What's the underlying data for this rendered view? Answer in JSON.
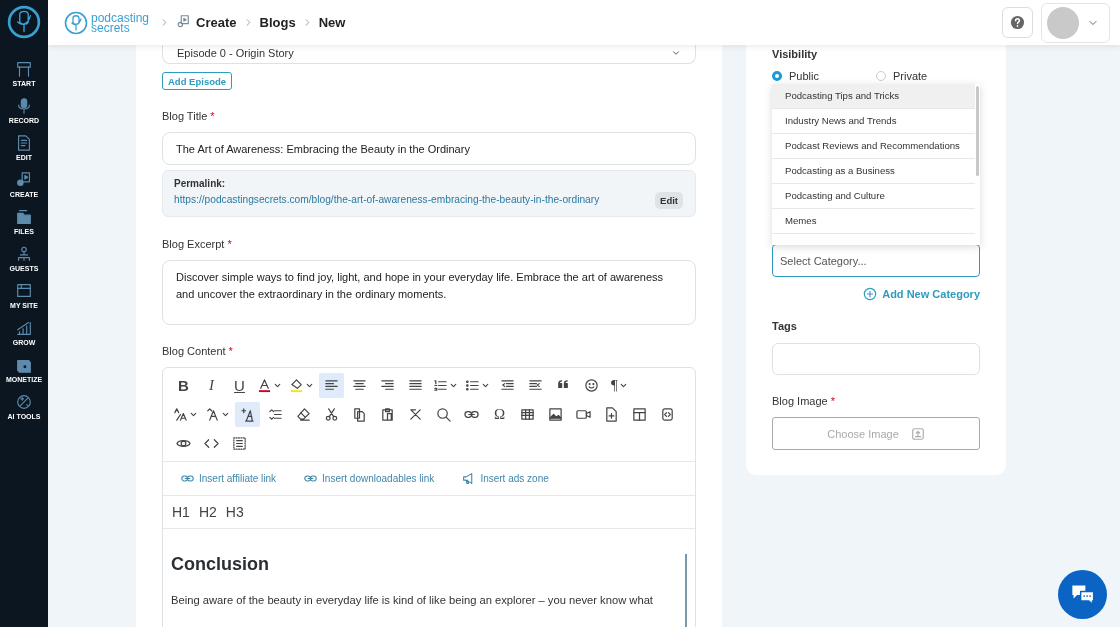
{
  "sidebar": {
    "items": [
      {
        "kind": "start",
        "label": "START"
      },
      {
        "kind": "record",
        "label": "RECORD"
      },
      {
        "kind": "edit",
        "label": "EDIT"
      },
      {
        "kind": "create",
        "label": "CREATE"
      },
      {
        "kind": "files",
        "label": "FILES"
      },
      {
        "kind": "guests",
        "label": "GUESTS"
      },
      {
        "kind": "site",
        "label": "MY SITE"
      },
      {
        "kind": "grow",
        "label": "GROW"
      },
      {
        "kind": "monetize",
        "label": "MONETIZE"
      },
      {
        "kind": "ai",
        "label": "AI TOOLS"
      }
    ]
  },
  "header": {
    "logo": {
      "line_1": "podcasting",
      "line_2": "secrets"
    },
    "breadcrumb": [
      "Create",
      "Blogs",
      "New"
    ]
  },
  "episode": {
    "value": "Episode 0 - Origin Story"
  },
  "add_episode": "Add Episode",
  "blog_title": {
    "label": "Blog Title",
    "marker": "*",
    "value": "The Art of Awareness: Embracing the Beauty in the Ordinary"
  },
  "permalink": {
    "label": "Permalink:",
    "url": "https://podcastingsecrets.com/blog/the-art-of-awareness-embracing-the-beauty-in-the-ordinary",
    "edit": "Edit"
  },
  "blog_excerpt": {
    "label": "Blog Excerpt",
    "marker": "*",
    "value": "Discover simple ways to find joy, light, and hope in your everyday life. Embrace the art of awareness and uncover the extraordinary in the ordinary moments."
  },
  "blog_content": {
    "label": "Blog Content",
    "marker": "*",
    "toolbar": [
      [
        {
          "kind": "bold",
          "label": "B",
          "selected": false,
          "dropdown": false
        },
        {
          "kind": "italic",
          "label": "I",
          "selected": false,
          "dropdown": false
        },
        {
          "kind": "underline",
          "label": "U",
          "selected": false,
          "dropdown": false
        },
        {
          "kind": "text-color",
          "selected": false,
          "dropdown": true
        },
        {
          "kind": "highlight",
          "selected": false,
          "dropdown": true
        },
        {
          "kind": "align-left",
          "selected": true,
          "dropdown": false
        },
        {
          "kind": "align-center",
          "selected": false,
          "dropdown": false
        },
        {
          "kind": "align-right",
          "selected": false,
          "dropdown": false
        },
        {
          "kind": "justify",
          "selected": false,
          "dropdown": false
        },
        {
          "kind": "ordered-list",
          "selected": false,
          "dropdown": true
        },
        {
          "kind": "bullet-list",
          "selected": false,
          "dropdown": true
        },
        {
          "kind": "outdent",
          "selected": false,
          "dropdown": false
        },
        {
          "kind": "indent",
          "selected": false,
          "dropdown": false
        },
        {
          "kind": "quote",
          "selected": false,
          "dropdown": false
        },
        {
          "kind": "emoji",
          "selected": false,
          "dropdown": false
        },
        {
          "kind": "paragraph",
          "label": "¶",
          "selected": false,
          "dropdown": true
        }
      ],
      [
        {
          "kind": "font-size-ratio",
          "selected": false,
          "dropdown": true
        },
        {
          "kind": "font-size",
          "selected": false,
          "dropdown": true
        },
        {
          "kind": "text-style",
          "selected": true,
          "dropdown": false
        },
        {
          "kind": "line-height",
          "selected": false,
          "dropdown": false
        },
        {
          "kind": "eraser",
          "selected": false,
          "dropdown": false
        },
        {
          "kind": "cut",
          "selected": false,
          "dropdown": false
        },
        {
          "kind": "copy",
          "selected": false,
          "dropdown": false
        },
        {
          "kind": "paste",
          "selected": false,
          "dropdown": false
        },
        {
          "kind": "clear",
          "selected": false,
          "dropdown": false
        },
        {
          "kind": "search",
          "selected": false,
          "dropdown": false
        },
        {
          "kind": "link",
          "selected": false,
          "dropdown": false
        },
        {
          "kind": "symbol",
          "label": "Ω",
          "selected": false,
          "dropdown": false
        },
        {
          "kind": "table",
          "selected": false,
          "dropdown": false
        },
        {
          "kind": "image",
          "selected": false,
          "dropdown": false
        },
        {
          "kind": "video",
          "selected": false,
          "dropdown": false
        },
        {
          "kind": "file",
          "selected": false,
          "dropdown": false
        },
        {
          "kind": "layout",
          "selected": false,
          "dropdown": false
        },
        {
          "kind": "embed",
          "selected": false,
          "dropdown": false
        }
      ],
      [
        {
          "kind": "preview",
          "selected": false,
          "dropdown": false
        },
        {
          "kind": "code",
          "selected": false,
          "dropdown": false
        },
        {
          "kind": "select-all",
          "selected": false,
          "dropdown": false
        }
      ]
    ],
    "inserts": [
      {
        "kind": "link",
        "label": "Insert affiliate link"
      },
      {
        "kind": "link",
        "label": "Insert downloadables link"
      },
      {
        "kind": "megaphone",
        "label": "Insert ads zone"
      }
    ],
    "headings": [
      "H1",
      "H2",
      "H3"
    ],
    "body": {
      "heading": "Conclusion",
      "paragraph": "Being aware of the beauty in everyday life is kind of like being an explorer – you never know what"
    }
  },
  "visibility": {
    "label": "Visibility",
    "options": [
      {
        "label": "Public",
        "selected": true
      },
      {
        "label": "Private",
        "selected": false
      }
    ]
  },
  "category": {
    "options": [
      {
        "label": "Podcasting Tips and Tricks",
        "selected": true
      },
      {
        "label": "Industry News and Trends",
        "selected": false
      },
      {
        "label": "Podcast Reviews and Recommendations",
        "selected": false
      },
      {
        "label": "Podcasting as a Business",
        "selected": false
      },
      {
        "label": "Podcasting and Culture",
        "selected": false
      },
      {
        "label": "Memes",
        "selected": false
      }
    ],
    "placeholder": "Select Category...",
    "add": "Add New Category"
  },
  "tags": {
    "label": "Tags"
  },
  "blog_image": {
    "label": "Blog Image",
    "marker": "*",
    "button": "Choose Image"
  }
}
